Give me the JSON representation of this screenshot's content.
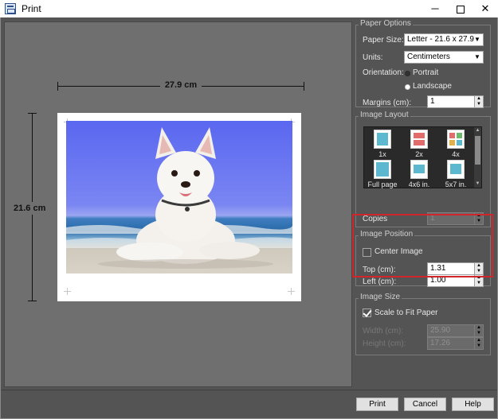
{
  "window": {
    "title": "Print",
    "controls": {
      "minimize": "─",
      "close": "✕"
    }
  },
  "preview": {
    "width_label": "27.9 cm",
    "height_label": "21.6 cm"
  },
  "paper_options": {
    "title": "Paper Options",
    "paper_size_label": "Paper Size:",
    "paper_size_value": "Letter - 21.6 x 27.9",
    "units_label": "Units:",
    "units_value": "Centimeters",
    "orientation_label": "Orientation:",
    "portrait_label": "Portrait",
    "landscape_label": "Landscape",
    "orientation_selected": "Landscape",
    "margins_label": "Margins (cm):",
    "margins_value": "1"
  },
  "image_layout": {
    "title": "Image Layout",
    "tiles": [
      {
        "label": "1x"
      },
      {
        "label": "2x"
      },
      {
        "label": "4x"
      },
      {
        "label": "Full page"
      },
      {
        "label": "4x6 in."
      },
      {
        "label": "5x7 in."
      }
    ],
    "copies_label": "Copies",
    "copies_value": "1"
  },
  "image_position": {
    "title": "Image Position",
    "center_image_label": "Center Image",
    "center_image_checked": false,
    "top_label": "Top (cm):",
    "top_value": "1.31",
    "left_label": "Left (cm):",
    "left_value": "1.00"
  },
  "image_size": {
    "title": "Image Size",
    "scale_to_fit_label": "Scale to Fit Paper",
    "scale_to_fit_checked": true,
    "width_label": "Width (cm):",
    "width_value": "25.90",
    "height_label": "Height (cm):",
    "height_value": "17.26"
  },
  "buttons": {
    "print": "Print",
    "cancel": "Cancel",
    "help": "Help"
  },
  "colors": {
    "highlight": "#d0262b",
    "background": "#545454",
    "preview_bg": "#6f6f6f"
  }
}
